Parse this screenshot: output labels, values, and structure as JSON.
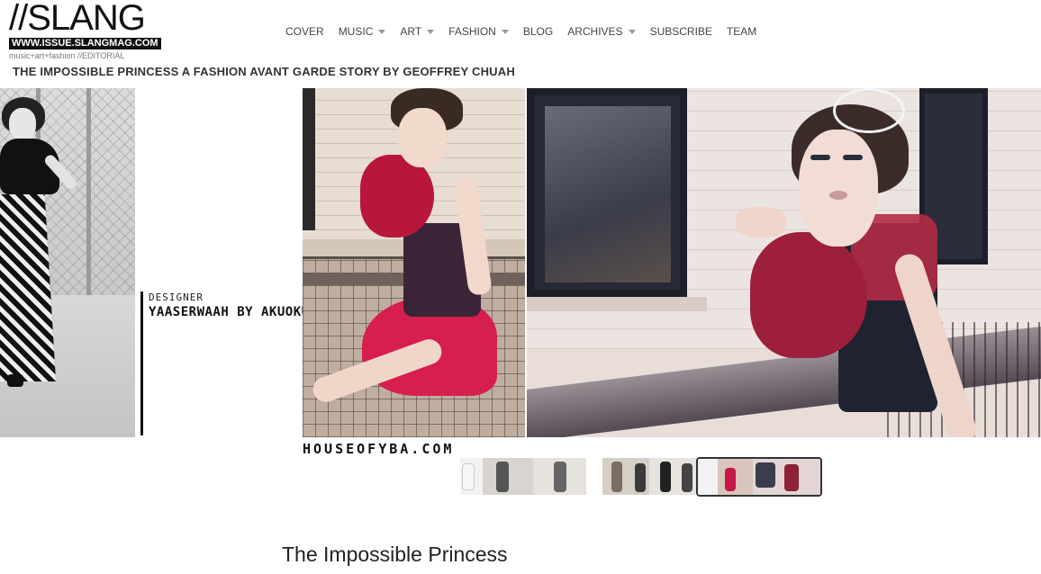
{
  "logo": {
    "title": "//SLANG",
    "url": "WWW.ISSUE.SLANGMAG.COM",
    "tagline": "music+art+fashion //EDITORIAL"
  },
  "nav": {
    "items": [
      {
        "label": "COVER",
        "has_dropdown": false
      },
      {
        "label": "MUSIC",
        "has_dropdown": true
      },
      {
        "label": "ART",
        "has_dropdown": true
      },
      {
        "label": "FASHION",
        "has_dropdown": true
      },
      {
        "label": "BLOG",
        "has_dropdown": false
      },
      {
        "label": "ARCHIVES",
        "has_dropdown": true
      },
      {
        "label": "SUBSCRIBE",
        "has_dropdown": false
      },
      {
        "label": "TEAM",
        "has_dropdown": false
      }
    ]
  },
  "article": {
    "title": "THE IMPOSSIBLE PRINCESS A FASHION AVANT GARDE STORY BY GEOFFREY CHUAH"
  },
  "slide": {
    "designer_label": "DESIGNER",
    "designer_name": "YAASERWAAH BY AKUOKU",
    "photo_credit": "HOUSEOFYBA.COM"
  },
  "thumbnails": {
    "count": 3,
    "active_index": 2
  },
  "post": {
    "heading": "The Impossible Princess"
  },
  "colors": {
    "accent_red": "#d61f4f",
    "text_dark": "#333333",
    "nav_text": "#444444",
    "logo_black": "#111111"
  },
  "icons": {
    "dropdown": "caret-down-icon"
  }
}
